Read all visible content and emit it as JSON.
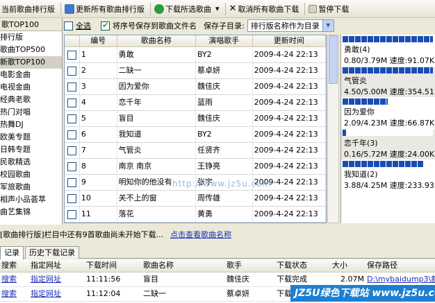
{
  "toolbar": {
    "b1": "当前歌曲排行版",
    "b2": "更新所有歌曲排行版",
    "b3": "下载所选歌曲",
    "b3_arrow": "▾",
    "b4": "取消所有歌曲下载",
    "b5": "暂停下载"
  },
  "sidebar": {
    "title": "歌TOP100",
    "items": [
      "排行版",
      "歌曲TOP500",
      "新歌TOP100",
      "电影金曲",
      "电视金曲",
      "经典老歌",
      "热门对唱",
      "热舞DJ",
      "欧美专题",
      "日韩专题",
      "民歌精选",
      "校园歌曲",
      "军旅歌曲",
      "相声小品荟萃",
      "曲艺集锦"
    ]
  },
  "options": {
    "select_all": "全选",
    "save_index": "将序号保存到歌曲文件名",
    "subdir_label": "保存子目录:",
    "subdir_value": "排行版名称作为目录"
  },
  "grid": {
    "headers": [
      "编号",
      "歌曲名称",
      "演唱歌手",
      "更新时间"
    ],
    "rows": [
      {
        "no": "1",
        "song": "勇敢",
        "singer": "BY2",
        "time": "2009-4-24 22:13"
      },
      {
        "no": "2",
        "song": "二缺一",
        "singer": "蔡卓妍",
        "time": "2009-4-24 22:13"
      },
      {
        "no": "3",
        "song": "因为爱你",
        "singer": "魏佳庆",
        "time": "2009-4-24 22:13"
      },
      {
        "no": "4",
        "song": "恋千年",
        "singer": "蓝雨",
        "time": "2009-4-24 22:13"
      },
      {
        "no": "5",
        "song": "盲目",
        "singer": "魏佳庆",
        "time": "2009-4-24 22:13"
      },
      {
        "no": "6",
        "song": "我知道",
        "singer": "BY2",
        "time": "2009-4-24 22:13"
      },
      {
        "no": "7",
        "song": "气管炎",
        "singer": "任贤齐",
        "time": "2009-4-24 22:13"
      },
      {
        "no": "8",
        "song": "南京 南京",
        "singer": "王铮亮",
        "time": "2009-4-24 22:13"
      },
      {
        "no": "9",
        "song": "明知你的他没有",
        "singer": "张宇",
        "time": "2009-4-24 22:13"
      },
      {
        "no": "10",
        "song": "关不上的窗",
        "singer": "周传雄",
        "time": "2009-4-24 22:13"
      },
      {
        "no": "11",
        "song": "落花",
        "singer": "黄勇",
        "time": "2009-4-24 22:13"
      }
    ]
  },
  "progress": [
    {
      "name": "勇敢(4)",
      "status": "0.80/3.79M 速度:91.07K",
      "fraction": 1.0
    },
    {
      "name": "气管炎",
      "status": "4.50/5.00M 速度:354.51",
      "fraction": 1.0
    },
    {
      "name": "因为爱你",
      "status": "2.09/4.23M 速度:66.87K",
      "fraction": 0.5
    },
    {
      "name": "恋千年(3)",
      "status": "0.16/5.72M 速度:24.00K",
      "fraction": 0.04
    },
    {
      "name": "我知道(2)",
      "status": "3.88/4.25M 速度:233.93",
      "fraction": 0.9
    }
  ],
  "message": {
    "text": "[歌曲排行版]栏目中还有9首歌曲尚未开始下载...",
    "link": "点击查看歌曲名称"
  },
  "tabs": [
    "记录",
    "历史下载记录"
  ],
  "bottom": {
    "headers": [
      "搜索",
      "指定网址",
      "下载时间",
      "歌曲名称",
      "歌手",
      "下载状态",
      "大小",
      "保存路径"
    ],
    "rows": [
      {
        "search": "搜索",
        "url": "指定网址",
        "time": "11:11:56",
        "song": "盲目",
        "singer": "魏佳庆",
        "status": "下载完成",
        "size": "2.07M",
        "path": "D:\\mybaidump3\\新"
      },
      {
        "search": "搜索",
        "url": "指定网址",
        "time": "11:12:04",
        "song": "二缺一",
        "singer": "蔡卓妍",
        "status": "下载完成",
        "size": "",
        "path": ""
      }
    ]
  },
  "watermark": {
    "text": "JZ5U绿色下载站 www.jz5u.com",
    "faint": "http://www.jz5u.com"
  }
}
